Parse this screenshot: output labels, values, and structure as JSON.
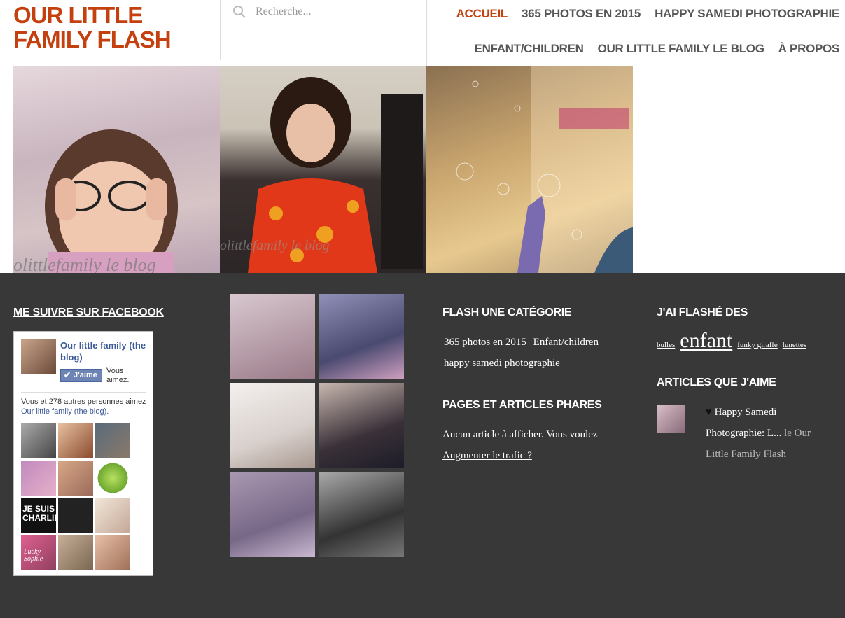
{
  "header": {
    "logo_line1": "OUR LITTLE",
    "logo_line2": "FAMILY FLASH",
    "search_placeholder": "Recherche...",
    "nav_row1": [
      "ACCUEIL",
      "365 PHOTOS EN 2015",
      "HAPPY SAMEDI PHOTOGRAPHIE"
    ],
    "nav_row2": [
      "ENFANT/CHILDREN",
      "OUR LITTLE FAMILY LE BLOG",
      "À PROPOS"
    ],
    "accent_color": "#c4400f"
  },
  "hero": {
    "watermark1": "olittlefamily le blog",
    "watermark2": "olittlefamily le blog"
  },
  "footer": {
    "background_color": "#383838",
    "facebook": {
      "title": "ME SUIVRE SUR FACEBOOK",
      "page_name": "Our little family (the blog)",
      "like_button": "J'aime",
      "vous_aimez": "Vous aimez.",
      "count_text": "Vous et 278 autres personnes aimez",
      "count_link": "Our little family (the blog).",
      "face_je_suis": "JE SUIS CHARLIE",
      "face_lucky": "Lucky Sophie"
    },
    "categories": {
      "title": "FLASH UNE CATÉGORIE",
      "items": [
        "365 photos en 2015",
        "Enfant/children",
        "happy samedi photographie"
      ]
    },
    "pages": {
      "title": "PAGES ET ARTICLES PHARES",
      "text": "Aucun article à afficher. Vous voulez",
      "link": "Augmenter le trafic ?"
    },
    "tags": {
      "title": "J'AI FLASHÉ DES",
      "items": [
        "bulles",
        "enfant",
        "funky giraffe",
        "lunettes"
      ]
    },
    "liked": {
      "title": "ARTICLES QUE J'AIME",
      "post_link": " Happy Samedi Photographie: L...",
      "le": "le",
      "blog_link": "Our Little Family Flash"
    }
  }
}
